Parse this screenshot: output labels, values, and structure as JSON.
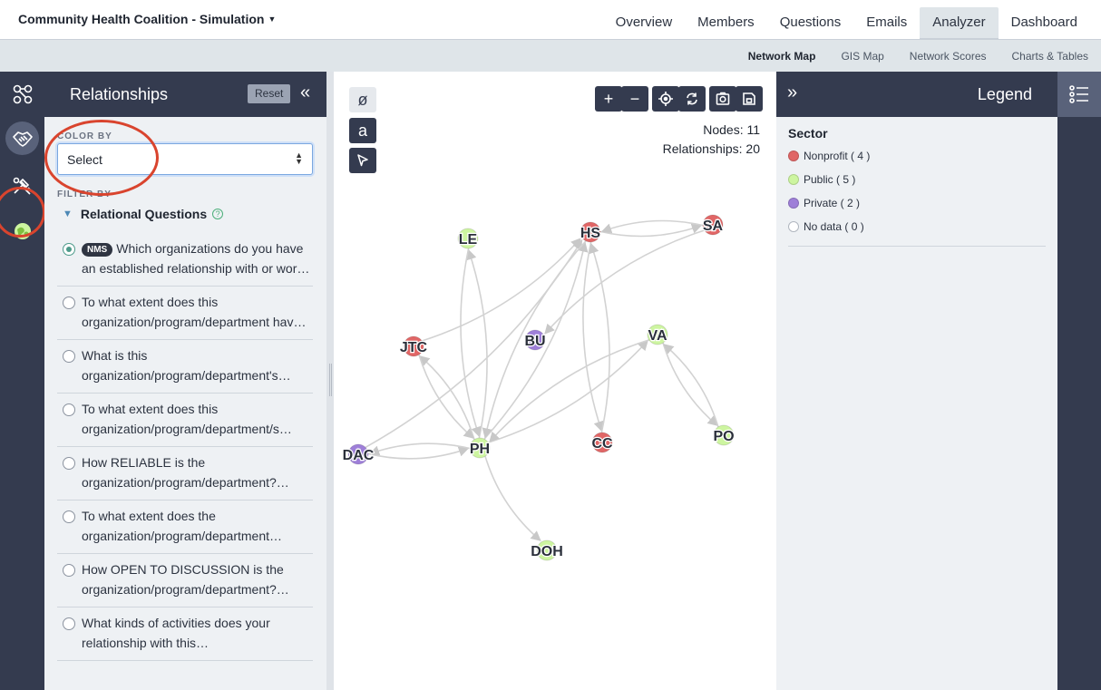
{
  "project": {
    "title": "Community Health Coalition - Simulation"
  },
  "main_tabs": [
    "Overview",
    "Members",
    "Questions",
    "Emails",
    "Analyzer",
    "Dashboard"
  ],
  "active_main_tab": "Analyzer",
  "sub_tabs": [
    "Network Map",
    "GIS Map",
    "Network Scores",
    "Charts & Tables"
  ],
  "active_sub_tab": "Network Map",
  "left_panel": {
    "title": "Relationships",
    "reset_label": "Reset",
    "color_by_label": "COLOR BY",
    "color_by_value": "Select",
    "filter_by_label": "FILTER BY",
    "section_title": "Relational Questions",
    "questions": [
      {
        "badge": "NMS",
        "line1": "Which organizations do you have",
        "line2": "an established relationship with or wor…",
        "selected": true
      },
      {
        "line1": "To what extent does this",
        "line2": "organization/program/department hav…",
        "selected": false
      },
      {
        "line1": "What is this",
        "line2": "organization/program/department's…",
        "selected": false
      },
      {
        "line1": "To what extent does this",
        "line2": "organization/program/department/s…",
        "selected": false
      },
      {
        "line1": "How RELIABLE is the",
        "line2": "organization/program/department?…",
        "selected": false
      },
      {
        "line1": "To what extent does the",
        "line2": "organization/program/department…",
        "selected": false
      },
      {
        "line1": "How OPEN TO DISCUSSION is the",
        "line2": "organization/program/department?…",
        "selected": false
      },
      {
        "line1": "What kinds of activities does your",
        "line2": "relationship with this…",
        "selected": false
      }
    ]
  },
  "canvas": {
    "nodes_stat": "Nodes: 11",
    "relationships_stat": "Relationships: 20",
    "text_tool": "a"
  },
  "legend": {
    "title": "Legend",
    "group_title": "Sector",
    "items": [
      {
        "label": "Nonprofit ( 4 )",
        "color": "#e06666"
      },
      {
        "label": "Public ( 5 )",
        "color": "#cdf5a0"
      },
      {
        "label": "Private ( 2 )",
        "color": "#9e7fd8"
      },
      {
        "label": "No data ( 0 )",
        "color": "#ffffff"
      }
    ]
  },
  "network": {
    "nodes": [
      {
        "id": "LE",
        "sector": "Public"
      },
      {
        "id": "HS",
        "sector": "Nonprofit"
      },
      {
        "id": "SA",
        "sector": "Nonprofit"
      },
      {
        "id": "BU",
        "sector": "Private"
      },
      {
        "id": "VA",
        "sector": "Public"
      },
      {
        "id": "JTC",
        "sector": "Nonprofit"
      },
      {
        "id": "DAC",
        "sector": "Private"
      },
      {
        "id": "PH",
        "sector": "Public"
      },
      {
        "id": "CC",
        "sector": "Nonprofit"
      },
      {
        "id": "PO",
        "sector": "Public"
      },
      {
        "id": "DOH",
        "sector": "Public"
      }
    ],
    "edges": [
      [
        "HS",
        "SA"
      ],
      [
        "SA",
        "HS"
      ],
      [
        "SA",
        "BU"
      ],
      [
        "PH",
        "LE"
      ],
      [
        "LE",
        "PH"
      ],
      [
        "JTC",
        "HS"
      ],
      [
        "PH",
        "HS"
      ],
      [
        "DAC",
        "HS"
      ],
      [
        "HS",
        "PH"
      ],
      [
        "HS",
        "CC"
      ],
      [
        "CC",
        "HS"
      ],
      [
        "PH",
        "JTC"
      ],
      [
        "JTC",
        "PH"
      ],
      [
        "PH",
        "VA"
      ],
      [
        "VA",
        "PH"
      ],
      [
        "VA",
        "PO"
      ],
      [
        "PO",
        "VA"
      ],
      [
        "DAC",
        "PH"
      ],
      [
        "PH",
        "DAC"
      ],
      [
        "PH",
        "DOH"
      ]
    ]
  }
}
